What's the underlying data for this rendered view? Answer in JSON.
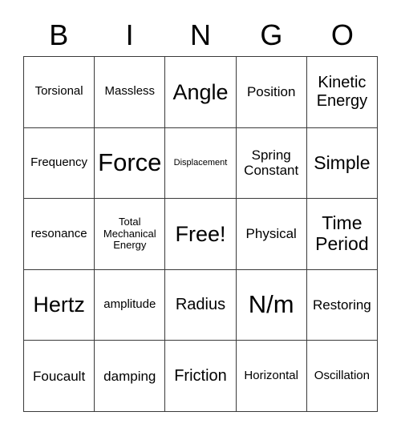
{
  "card": {
    "title": "BINGO",
    "header_letters": [
      "B",
      "I",
      "N",
      "G",
      "O"
    ],
    "rows": 5,
    "columns": 5,
    "free_space": "Free!",
    "colors": {
      "background": "#ffffff",
      "border": "#3a3a3a",
      "text": "#000000"
    },
    "cells": [
      [
        {
          "text": "Torsional",
          "size": "sz-m"
        },
        {
          "text": "Massless",
          "size": "sz-m"
        },
        {
          "text": "Angle",
          "size": "sz-xxl"
        },
        {
          "text": "Position",
          "size": "sz-ml"
        },
        {
          "text": "Kinetic\nEnergy",
          "size": "sz-l"
        }
      ],
      [
        {
          "text": "Frequency",
          "size": "sz-m"
        },
        {
          "text": "Force",
          "size": "sz-huge"
        },
        {
          "text": "Displacement",
          "size": "sz-xs"
        },
        {
          "text": "Spring\nConstant",
          "size": "sz-ml"
        },
        {
          "text": "Simple",
          "size": "sz-xl"
        }
      ],
      [
        {
          "text": "resonance",
          "size": "sz-m"
        },
        {
          "text": "Total\nMechanical\nEnergy",
          "size": "sz-s"
        },
        {
          "text": "Free!",
          "size": "sz-xxl"
        },
        {
          "text": "Physical",
          "size": "sz-ml"
        },
        {
          "text": "Time\nPeriod",
          "size": "sz-xl"
        }
      ],
      [
        {
          "text": "Hertz",
          "size": "sz-xxl"
        },
        {
          "text": "amplitude",
          "size": "sz-m"
        },
        {
          "text": "Radius",
          "size": "sz-l"
        },
        {
          "text": "N/m",
          "size": "sz-huge"
        },
        {
          "text": "Restoring",
          "size": "sz-ml"
        }
      ],
      [
        {
          "text": "Foucault",
          "size": "sz-ml"
        },
        {
          "text": "damping",
          "size": "sz-ml"
        },
        {
          "text": "Friction",
          "size": "sz-l"
        },
        {
          "text": "Horizontal",
          "size": "sz-m"
        },
        {
          "text": "Oscillation",
          "size": "sz-m"
        }
      ]
    ]
  }
}
